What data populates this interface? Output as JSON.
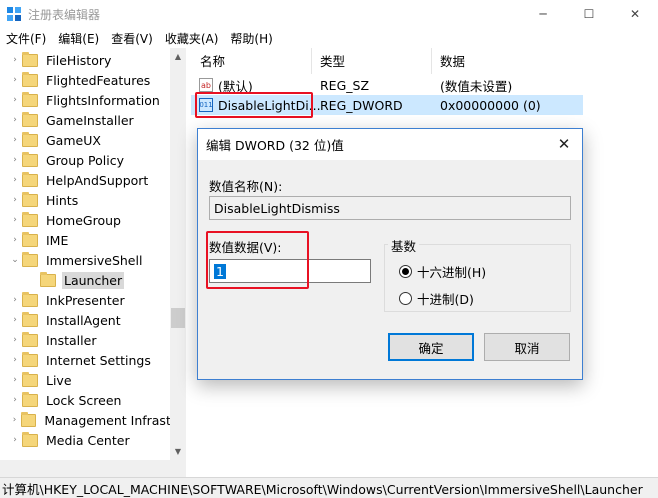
{
  "window": {
    "title": "注册表编辑器",
    "minimize_glyph": "─",
    "maximize_glyph": "☐",
    "close_glyph": "✕"
  },
  "menu": [
    "文件(F)",
    "编辑(E)",
    "查看(V)",
    "收藏夹(A)",
    "帮助(H)"
  ],
  "tree": {
    "items": [
      {
        "label": "FileHistory",
        "caret": "›"
      },
      {
        "label": "FlightedFeatures",
        "caret": "›"
      },
      {
        "label": "FlightsInformation",
        "caret": "›"
      },
      {
        "label": "GameInstaller",
        "caret": "›"
      },
      {
        "label": "GameUX",
        "caret": "›"
      },
      {
        "label": "Group Policy",
        "caret": "›"
      },
      {
        "label": "HelpAndSupport",
        "caret": "›"
      },
      {
        "label": "Hints",
        "caret": "›"
      },
      {
        "label": "HomeGroup",
        "caret": "›"
      },
      {
        "label": "IME",
        "caret": "›"
      },
      {
        "label": "ImmersiveShell",
        "caret": "⌄"
      },
      {
        "label": "Launcher",
        "caret": ""
      },
      {
        "label": "InkPresenter",
        "caret": "›"
      },
      {
        "label": "InstallAgent",
        "caret": "›"
      },
      {
        "label": "Installer",
        "caret": "›"
      },
      {
        "label": "Internet Settings",
        "caret": "›"
      },
      {
        "label": "Live",
        "caret": "›"
      },
      {
        "label": "Lock Screen",
        "caret": "›"
      },
      {
        "label": "Management Infrastr",
        "caret": "›"
      },
      {
        "label": "Media Center",
        "caret": "›"
      }
    ]
  },
  "list": {
    "headers": [
      "名称",
      "类型",
      "数据"
    ],
    "rows": [
      {
        "icon": "ab",
        "name": "(默认)",
        "type": "REG_SZ",
        "data": "(数值未设置)"
      },
      {
        "icon": "011",
        "name": "DisableLightDi...",
        "type": "REG_DWORD",
        "data": "0x00000000 (0)"
      }
    ]
  },
  "dialog": {
    "title": "编辑 DWORD (32 位)值",
    "name_label": "数值名称(N):",
    "name_value": "DisableLightDismiss",
    "data_label": "数值数据(V):",
    "data_value": "1",
    "base_label": "基数",
    "radio_hex": "十六进制(H)",
    "radio_dec": "十进制(D)",
    "ok": "确定",
    "cancel": "取消",
    "close_glyph": "✕"
  },
  "status": "计算机\\HKEY_LOCAL_MACHINE\\SOFTWARE\\Microsoft\\Windows\\CurrentVersion\\ImmersiveShell\\Launcher",
  "colors": {
    "highlight_box": "#e81123",
    "row_selected": "#cce8ff",
    "accent": "#0078d7"
  }
}
